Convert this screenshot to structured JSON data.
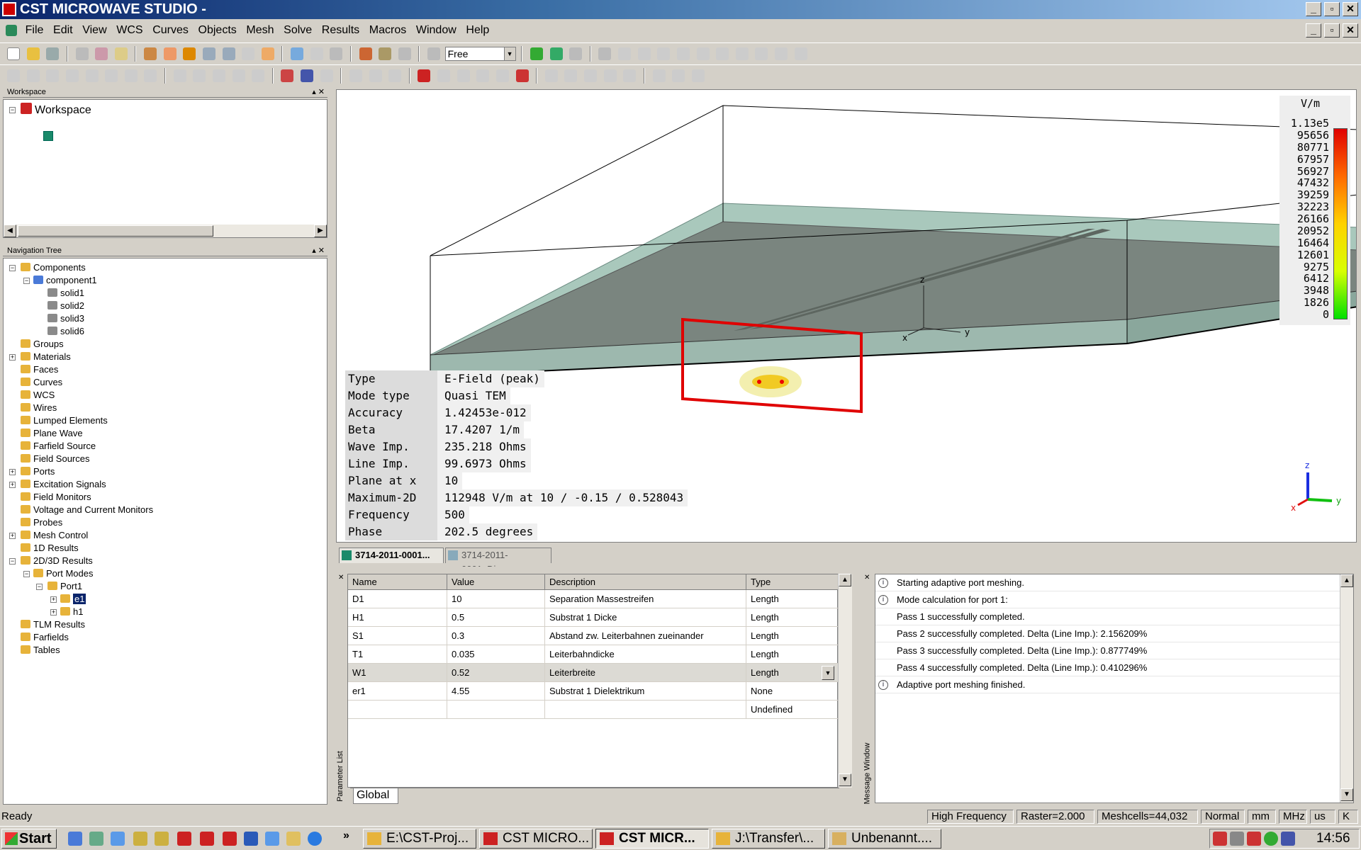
{
  "window": {
    "title": "CST MICROWAVE STUDIO -"
  },
  "menu": [
    "File",
    "Edit",
    "View",
    "WCS",
    "Curves",
    "Objects",
    "Mesh",
    "Solve",
    "Results",
    "Macros",
    "Window",
    "Help"
  ],
  "toolbar": {
    "mode_select": "Free"
  },
  "workspace": {
    "title": "Workspace",
    "root": "Workspace"
  },
  "navtree": {
    "title": "Navigation Tree",
    "items": [
      "Components",
      "component1",
      "solid1",
      "solid2",
      "solid3",
      "solid6",
      "Groups",
      "Materials",
      "Faces",
      "Curves",
      "WCS",
      "Wires",
      "Lumped Elements",
      "Plane Wave",
      "Farfield Source",
      "Field Sources",
      "Ports",
      "Excitation Signals",
      "Field Monitors",
      "Voltage and Current Monitors",
      "Probes",
      "Mesh Control",
      "1D Results",
      "2D/3D Results",
      "Port Modes",
      "Port1",
      "e1",
      "h1",
      "TLM Results",
      "Farfields",
      "Tables"
    ]
  },
  "view": {
    "info": [
      {
        "key": "Type",
        "value": "E-Field (peak)"
      },
      {
        "key": "Mode type",
        "value": "Quasi TEM"
      },
      {
        "key": "Accuracy",
        "value": "1.42453e-012"
      },
      {
        "key": "Beta",
        "value": "17.4207 1/m"
      },
      {
        "key": "Wave Imp.",
        "value": "235.218 Ohms"
      },
      {
        "key": "Line Imp.",
        "value": "99.6973 Ohms"
      },
      {
        "key": "Plane at x",
        "value": "10"
      },
      {
        "key": "Maximum-2D",
        "value": "112948 V/m at 10 / -0.15 / 0.528043"
      },
      {
        "key": "Frequency",
        "value": "500"
      },
      {
        "key": "Phase",
        "value": "202.5 degrees"
      }
    ],
    "legend_unit": "V/m",
    "legend_values": [
      "1.13e5",
      "95656",
      "80771",
      "67957",
      "56927",
      "47432",
      "39259",
      "32223",
      "26166",
      "20952",
      "16464",
      "12601",
      "9275",
      "6412",
      "3948",
      "1826",
      "0"
    ],
    "axes": {
      "x": "x",
      "y": "y",
      "z": "z"
    },
    "gradient_colors": [
      "#e00000",
      "#ff6a00",
      "#ffd200",
      "#d8ff00",
      "#00e000"
    ]
  },
  "doctabs": [
    "3714-2011-0001...",
    "3714-2011-0001_Di..."
  ],
  "params": {
    "panel_label": "Parameter List",
    "columns": [
      "Name",
      "Value",
      "Description",
      "Type"
    ],
    "rows": [
      {
        "name": "D1",
        "value": "10",
        "desc": "Separation Massestreifen",
        "type": "Length"
      },
      {
        "name": "H1",
        "value": "0.5",
        "desc": "Substrat 1 Dicke",
        "type": "Length"
      },
      {
        "name": "S1",
        "value": "0.3",
        "desc": "Abstand zw. Leiterbahnen zueinander",
        "type": "Length"
      },
      {
        "name": "T1",
        "value": "0.035",
        "desc": "Leiterbahndicke",
        "type": "Length"
      },
      {
        "name": "W1",
        "value": "0.52",
        "desc": "Leiterbreite",
        "type": "Length"
      },
      {
        "name": "er1",
        "value": "4.55",
        "desc": "Substrat 1 Dielektrikum",
        "type": "None"
      },
      {
        "name": "",
        "value": "",
        "desc": "",
        "type": "Undefined"
      }
    ],
    "tab": "Global"
  },
  "messages": {
    "panel_label": "Message Window",
    "items": [
      {
        "text": "Starting adaptive port meshing.",
        "info": true
      },
      {
        "text": "Mode calculation for port 1:",
        "info": true
      },
      {
        "text": "Pass 1 successfully completed.",
        "info": false
      },
      {
        "text": "Pass 2 successfully completed. Delta (Line Imp.): 2.156209%",
        "info": false
      },
      {
        "text": "Pass 3 successfully completed. Delta (Line Imp.): 0.877749%",
        "info": false
      },
      {
        "text": "Pass 4 successfully completed. Delta (Line Imp.): 0.410296%",
        "info": false
      },
      {
        "text": "Adaptive port meshing finished.",
        "info": true
      }
    ]
  },
  "status": {
    "ready": "Ready",
    "fields": [
      "High Frequency",
      "Raster=2.000",
      "Meshcells=44,032",
      "Normal",
      "mm",
      "MHz",
      "us",
      "K"
    ]
  },
  "taskbar": {
    "start": "Start",
    "tasks": [
      "E:\\CST-Proj...",
      "CST MICRO...",
      "CST MICR...",
      "J:\\Transfer\\...",
      "Unbenannt...."
    ],
    "clock": "14:56"
  }
}
